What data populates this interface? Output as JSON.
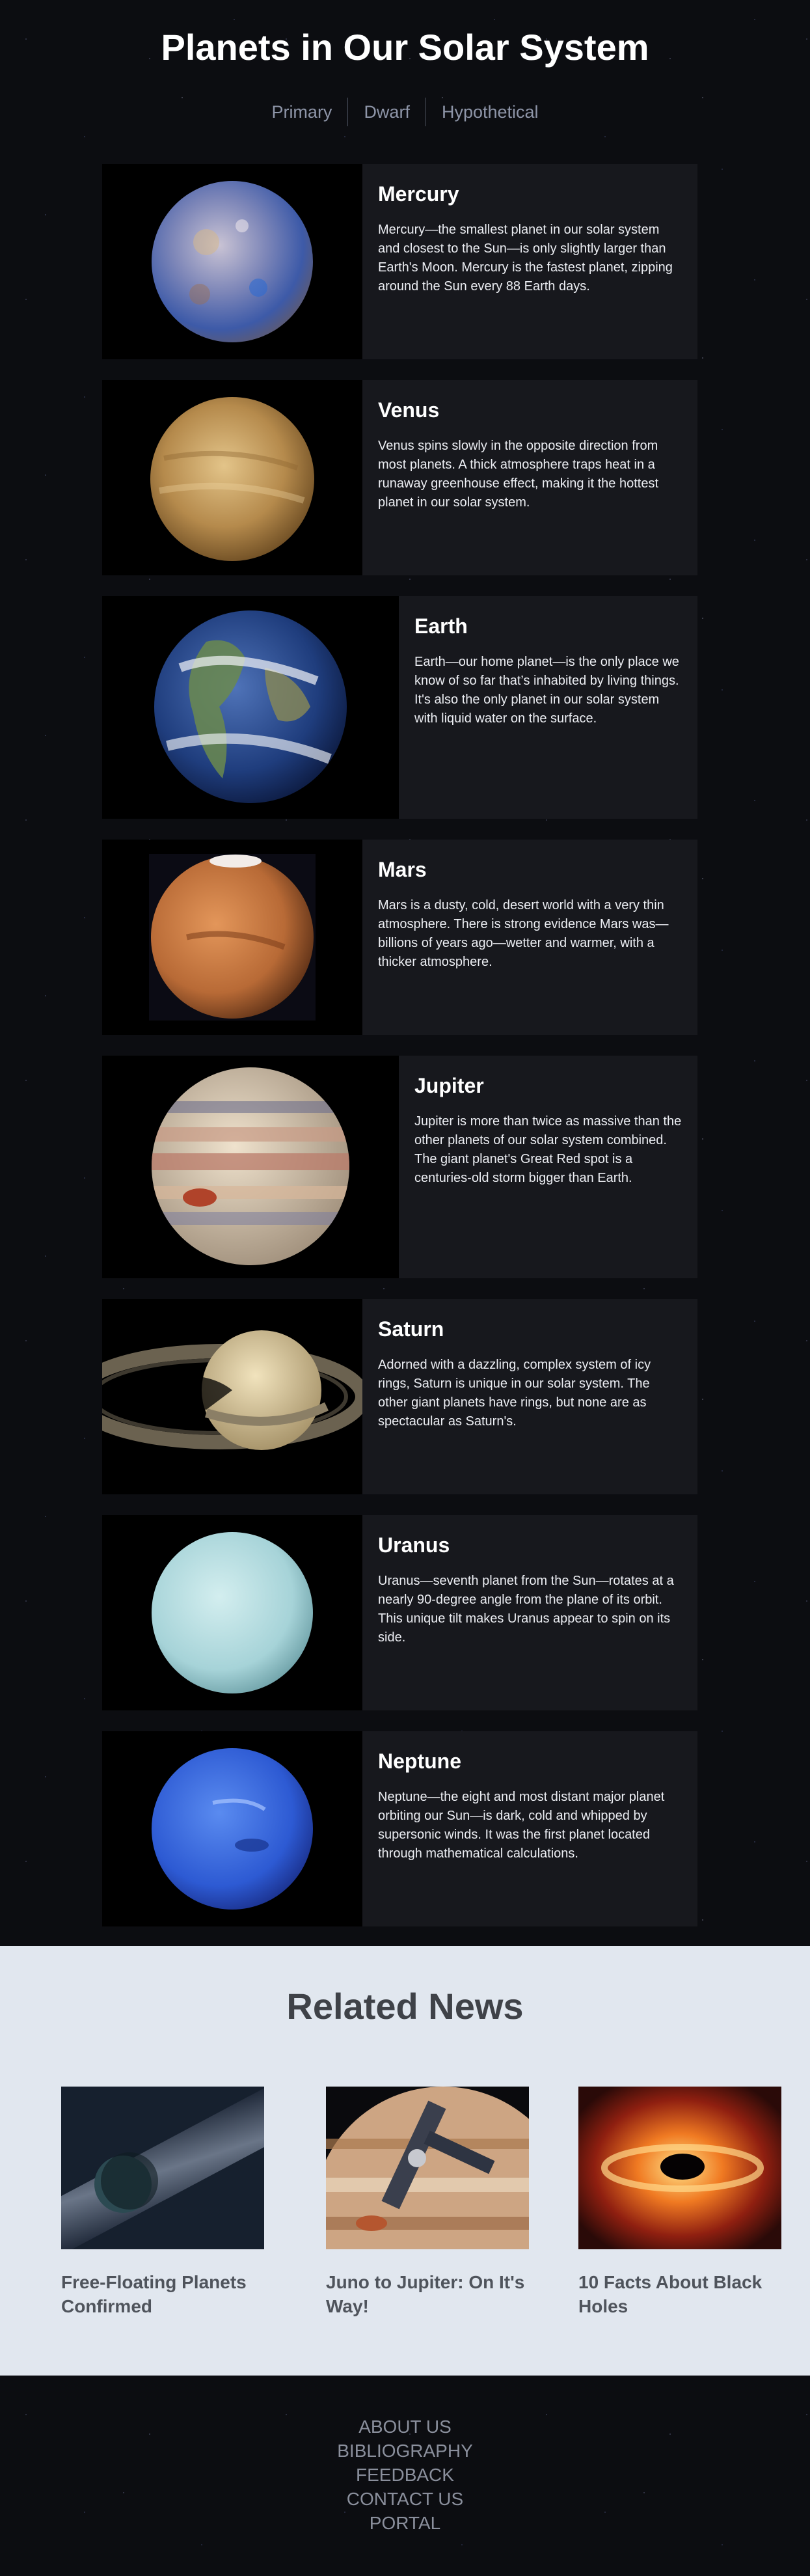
{
  "page": {
    "title": "Planets in Our Solar System"
  },
  "nav": {
    "items": [
      "Primary",
      "Dwarf",
      "Hypothetical"
    ]
  },
  "planets": [
    {
      "name": "Mercury",
      "text": "Mercury—the smallest planet in our solar system and closest to the Sun—is only slightly larger than Earth's Moon. Mercury is the fastest planet, zipping around the Sun every 88 Earth days."
    },
    {
      "name": "Venus",
      "text": "Venus spins slowly in the opposite direction from most planets. A thick atmosphere traps heat in a runaway greenhouse effect, making it the hottest planet in our solar system."
    },
    {
      "name": "Earth",
      "text": "Earth—our home planet—is the only place we know of so far that’s inhabited by living things. It's also the only planet in our solar system with liquid water on the surface."
    },
    {
      "name": "Mars",
      "text": "Mars is a dusty, cold, desert world with a very thin atmosphere. There is strong evidence Mars was—billions of years ago—wetter and warmer, with a thicker atmosphere."
    },
    {
      "name": "Jupiter",
      "text": "Jupiter is more than twice as massive than the other planets of our solar system combined. The giant planet's Great Red spot is a centuries-old storm bigger than Earth."
    },
    {
      "name": "Saturn",
      "text": "Adorned with a dazzling, complex system of icy rings, Saturn is unique in our solar system. The other giant planets have rings, but none are as spectacular as Saturn's."
    },
    {
      "name": "Uranus",
      "text": "Uranus—seventh planet from the Sun—rotates at a nearly 90-degree angle from the plane of its orbit. This unique tilt makes Uranus appear to spin on its side."
    },
    {
      "name": "Neptune",
      "text": "Neptune—the eight and most distant major planet orbiting our Sun—is dark, cold and whipped by supersonic winds. It was the first planet located through mathematical calculations."
    }
  ],
  "news": {
    "title": "Related News",
    "items": [
      {
        "caption": "Free-Floating Planets Confirmed"
      },
      {
        "caption": "Juno to Jupiter: On It's Way!"
      },
      {
        "caption": "10 Facts About Black Holes"
      }
    ]
  },
  "footer": {
    "links": [
      "ABOUT US",
      "BIBLIOGRAPHY",
      "FEEDBACK",
      "CONTACT US",
      "PORTAL"
    ]
  }
}
